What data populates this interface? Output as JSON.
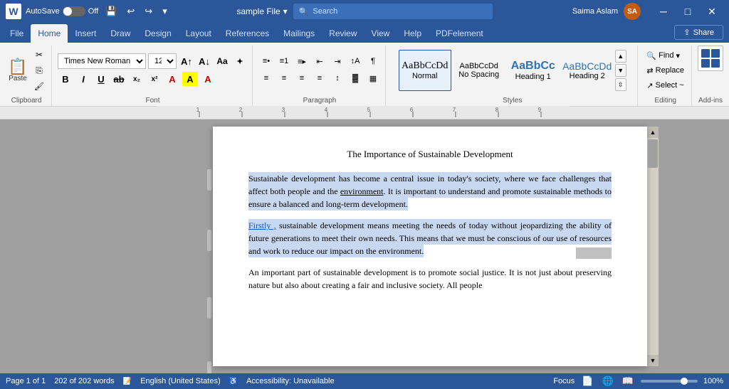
{
  "titlebar": {
    "autosave_label": "AutoSave",
    "toggle_state": "Off",
    "filename": "sample File",
    "search_placeholder": "Search",
    "user_name": "Saima Aslam",
    "user_initials": "SA",
    "minimize": "─",
    "maximize": "□",
    "close": "✕"
  },
  "ribbon_tabs": {
    "tabs": [
      "File",
      "Home",
      "Insert",
      "Draw",
      "Design",
      "Layout",
      "References",
      "Mailings",
      "Review",
      "View",
      "Help",
      "PDFelement"
    ],
    "active": "Home"
  },
  "share_btn": "⇪ Share",
  "ribbon": {
    "clipboard_label": "Clipboard",
    "font_label": "Font",
    "paragraph_label": "Paragraph",
    "styles_label": "Styles",
    "editing_label": "Editing",
    "addins_label": "Add-ins",
    "font_name": "Times New Roman",
    "font_size": "12",
    "styles": {
      "normal_label": "Normal",
      "nospacing_label": "No Spacing",
      "heading1_label": "Heading 1",
      "heading2_label": "Heading 2"
    },
    "find_label": "Find",
    "replace_label": "Replace",
    "select_label": "Select ~"
  },
  "document": {
    "title": "The Importance of Sustainable Development",
    "para1": "Sustainable development has become a central issue in today's society, where we face challenges that affect both people and the environment. It is important to understand and promote sustainable methods to ensure a balanced and long-term development.",
    "para1_underline": "environment",
    "para2_first": "Firstly ,",
    "para2_rest": " sustainable development means meeting the needs of today without jeopardizing the ability of future generations to meet their own needs. This means that we must be conscious of our use of resources and work to reduce our impact on the environment.",
    "para3": "An important part of sustainable development is to promote social justice. It is not just about preserving nature but also about creating a fair and inclusive society. All people"
  },
  "statusbar": {
    "page_info": "Page 1 of 1",
    "word_count": "202 of 202 words",
    "language": "English (United States)",
    "accessibility": "Accessibility: Unavailable",
    "focus": "Focus",
    "zoom": "100%"
  }
}
